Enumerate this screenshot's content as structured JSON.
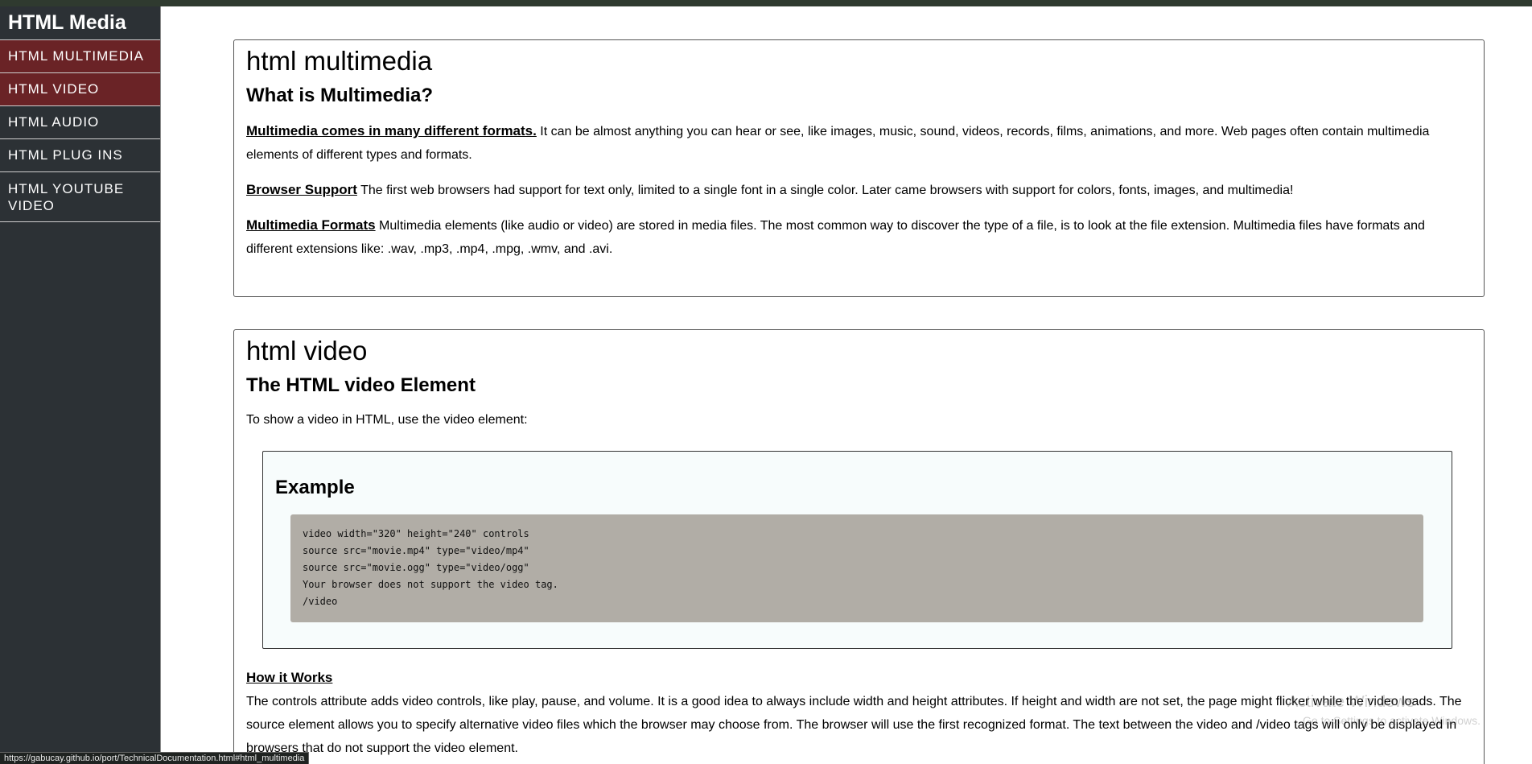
{
  "sidebar": {
    "brand": "HTML Media",
    "items": [
      {
        "label": "HTML MULTIMEDIA",
        "active": true
      },
      {
        "label": "HTML VIDEO",
        "active": true
      },
      {
        "label": "HTML AUDIO",
        "active": false
      },
      {
        "label": "HTML PLUG INS",
        "active": false
      },
      {
        "label": "HTML YOUTUBE VIDEO",
        "active": false
      }
    ],
    "active_color": "#6a2326",
    "bg_color": "#2c3135"
  },
  "sections": [
    {
      "title": "html multimedia",
      "subtitle": "What is Multimedia?",
      "paragraphs": [
        {
          "lead": "Multimedia comes in many different formats.",
          "text": " It can be almost anything you can hear or see, like images, music, sound, videos, records, films, animations, and more. Web pages often contain multimedia elements of different types and formats."
        },
        {
          "lead": "Browser Support",
          "text": " The first web browsers had support for text only, limited to a single font in a single color. Later came browsers with support for colors, fonts, images, and multimedia!"
        },
        {
          "lead": "Multimedia Formats",
          "text": " Multimedia elements (like audio or video) are stored in media files. The most common way to discover the type of a file, is to look at the file extension. Multimedia files have formats and different extensions like: .wav, .mp3, .mp4, .mpg, .wmv, and .avi."
        }
      ]
    },
    {
      "title": "html video",
      "subtitle": "The HTML video Element",
      "intro": "To show a video in HTML, use the video element:",
      "example": {
        "title": "Example",
        "code_lines": [
          "video width=\"320\" height=\"240\" controls",
          "source src=\"movie.mp4\" type=\"video/mp4\"",
          "source src=\"movie.ogg\" type=\"video/ogg\"",
          "Your browser does not support the video tag.",
          "/video"
        ]
      },
      "how_heading": "How it Works",
      "how_text": "The controls attribute adds video controls, like play, pause, and volume. It is a good idea to always include width and height attributes. If height and width are not set, the page might flicker while the video loads. The source element allows you to specify alternative video files which the browser may choose from. The browser will use the first recognized format. The text between the video and /video tags will only be displayed in browsers that do not support the video element."
    }
  ],
  "overlay": {
    "watermark_title": "Activate Windows",
    "watermark_sub": "Go to Settings to activate Windows.",
    "status_url": "https://gabucay.github.io/port/TechnicalDocumentation.html#html_multimedia"
  }
}
